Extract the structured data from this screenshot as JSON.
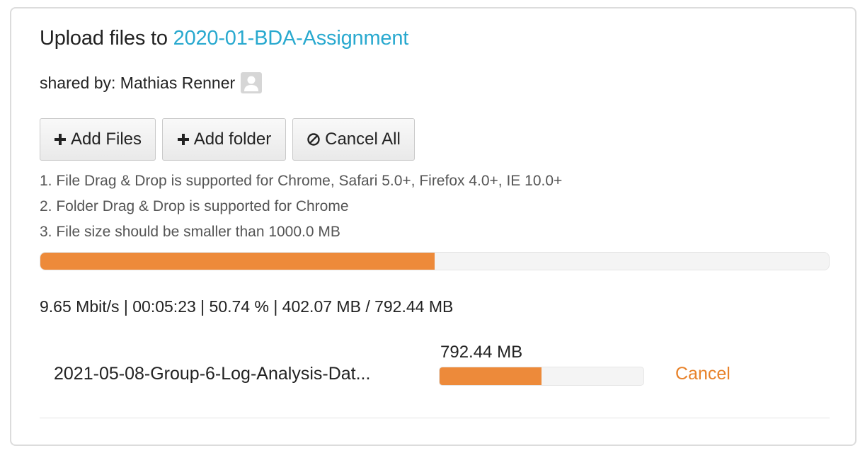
{
  "header": {
    "prefix": "Upload files to",
    "folder_name": "2020-01-BDA-Assignment"
  },
  "shared": {
    "label": "shared by: Mathias Renner",
    "avatar_icon": "user-avatar-icon"
  },
  "toolbar": {
    "add_files_label": "Add Files",
    "add_files_icon": "plus-icon",
    "add_folder_label": "Add folder",
    "add_folder_icon": "plus-icon",
    "cancel_all_label": "Cancel All",
    "cancel_all_icon": "ban-icon"
  },
  "notes": [
    "1.  File Drag & Drop is supported for Chrome, Safari 5.0+, Firefox 4.0+, IE 10.0+",
    "2.  Folder Drag & Drop is supported for Chrome",
    "3.  File size should be smaller than 1000.0 MB"
  ],
  "overall": {
    "progress": 0.5,
    "stats": "9.65 Mbit/s | 00:05:23 | 50.74 % | 402.07 MB / 792.44 MB"
  },
  "file": {
    "name": "2021-05-08-Group-6-Log-Analysis-Dat...",
    "size": "792.44 MB",
    "progress": 0.5,
    "cancel_label": "Cancel"
  },
  "colors": {
    "accent_link": "#29a9cf",
    "progress_fill": "#ed8a3a",
    "cancel_link": "#e8822a"
  }
}
